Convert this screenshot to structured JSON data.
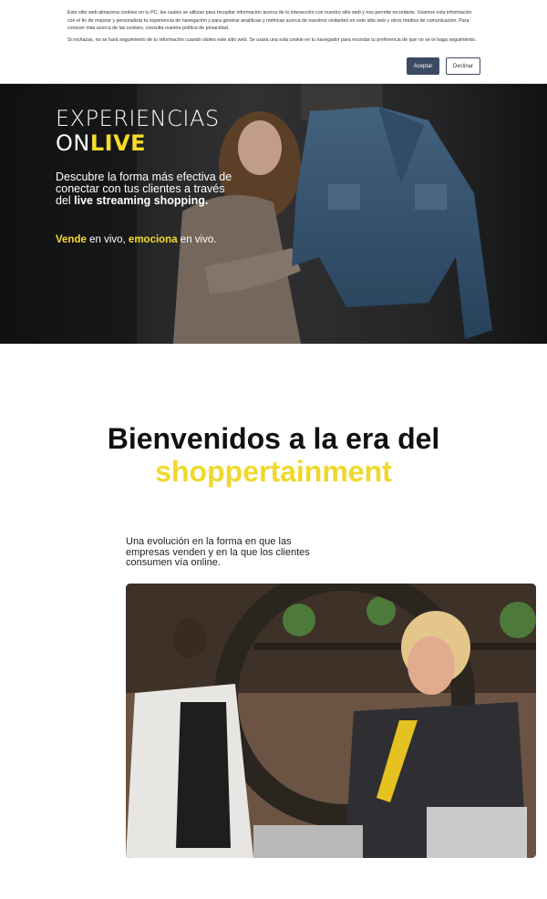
{
  "cookie_banner": {
    "text_1": "Este sitio web almacena cookies en tu PC, las cuales se utilizan para recopilar información acerca de tu interacción con nuestro sitio web y nos permite recordarte. Usamos esta información con el fin de mejorar y personalizar tu experiencia de navegación y para generar analíticas y métricas acerca de nuestros visitantes en este sitio web y otros medios de comunicación. Para conocer más acerca de las cookies, consulta nuestra política de privacidad.",
    "text_2": "Si rechazas, no se hará seguimiento de tu información cuando visites este sitio web. Se usará una sola cookie en tu navegador para recordar tu preferencia de que no se te haga seguimiento.",
    "accept_label": "Aceptar",
    "decline_label": "Declinar"
  },
  "hero": {
    "title_line1": "EXPERIENCIAS",
    "title_on": "ON",
    "title_live": "LIVE",
    "desc_plain": "Descubre la forma más efectiva de conectar con tus clientes a través del ",
    "desc_bold": "live streaming shopping.",
    "tag_word1": "Vende",
    "tag_text1": " en vivo, ",
    "tag_word2": "emociona",
    "tag_text2": " en vivo."
  },
  "welcome": {
    "title": "Bienvenidos a la era del",
    "accent": "shoppertainment",
    "intro": "Una evolución en la forma en que las empresas venden y en la que los clientes consumen vía online."
  },
  "colors": {
    "accent_yellow": "#f6dc2a",
    "button_dark": "#3c4a63"
  }
}
